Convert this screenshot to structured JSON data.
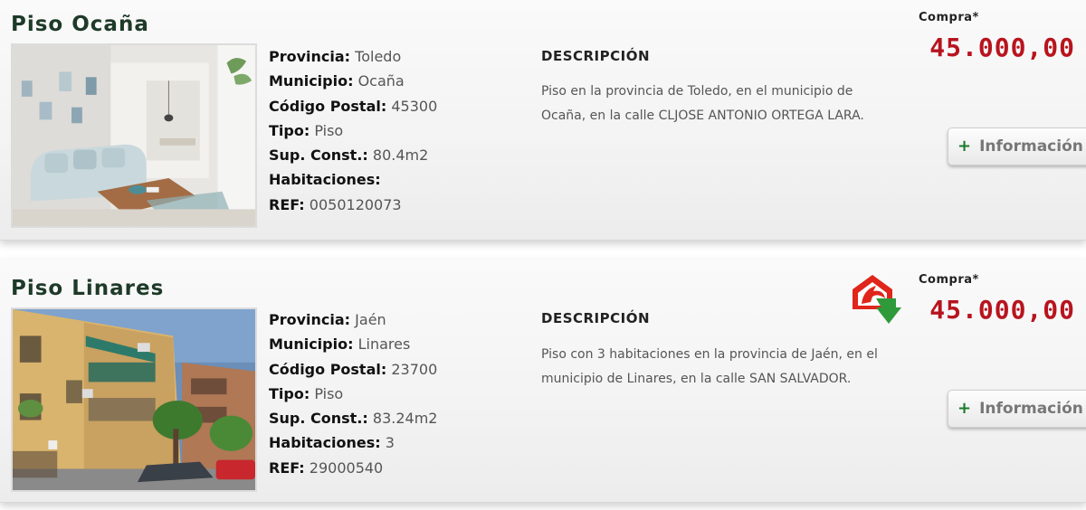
{
  "listings": [
    {
      "title": "Piso Ocaña",
      "specs": [
        {
          "label": "Provincia:",
          "value": "Toledo"
        },
        {
          "label": "Municipio:",
          "value": "Ocaña"
        },
        {
          "label": "Código Postal:",
          "value": "45300"
        },
        {
          "label": "Tipo:",
          "value": "Piso"
        },
        {
          "label": "Sup. Const.:",
          "value": "80.4m2"
        },
        {
          "label": "Habitaciones:",
          "value": ""
        },
        {
          "label": "REF:",
          "value": "0050120073"
        }
      ],
      "description_heading": "DESCRIPCIÓN",
      "description": "Piso en la provincia de Toledo, en el municipio de Ocaña, en la calle CLJOSE ANTONIO ORTEGA LARA.",
      "price_label": "Compra*",
      "price": "45.000,00",
      "button_label": "Información",
      "button_icon": "plus-icon"
    },
    {
      "title": "Piso Linares",
      "specs": [
        {
          "label": "Provincia:",
          "value": "Jaén"
        },
        {
          "label": "Municipio:",
          "value": "Linares"
        },
        {
          "label": "Código Postal:",
          "value": "23700"
        },
        {
          "label": "Tipo:",
          "value": "Piso"
        },
        {
          "label": "Sup. Const.:",
          "value": "83.24m2"
        },
        {
          "label": "Habitaciones:",
          "value": "3"
        },
        {
          "label": "REF:",
          "value": "29000540"
        }
      ],
      "description_heading": "DESCRIPCIÓN",
      "description": "Piso con 3 habitaciones en la provincia de Jaén, en el municipio de Linares, en la calle SAN SALVADOR.",
      "price_label": "Compra*",
      "price": "45.000,00",
      "button_label": "Información",
      "button_icon": "plus-icon",
      "badge_icon": "house-arrow-logo-icon"
    }
  ],
  "colors": {
    "title": "#1e3a28",
    "price": "#b8141e",
    "plus": "#1a7a2a",
    "logo_red": "#e0251b",
    "logo_green": "#2f9a3a"
  }
}
